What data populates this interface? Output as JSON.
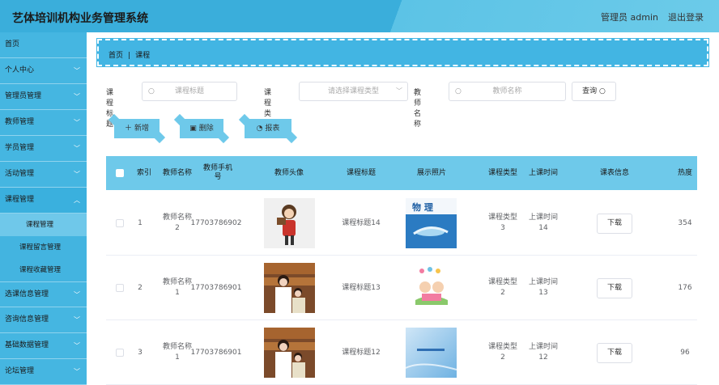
{
  "app": {
    "title": "艺体培训机构业务管理系统",
    "user": "管理员 admin",
    "logout": "退出登录"
  },
  "sidebar": {
    "items": [
      {
        "label": "首页"
      },
      {
        "label": "个人中心"
      },
      {
        "label": "管理员管理"
      },
      {
        "label": "教师管理"
      },
      {
        "label": "学员管理"
      },
      {
        "label": "活动管理"
      },
      {
        "label": "课程管理"
      },
      {
        "label": "选课信息管理"
      },
      {
        "label": "咨询信息管理"
      },
      {
        "label": "基础数据管理"
      },
      {
        "label": "论坛管理"
      }
    ],
    "subitems": [
      {
        "label": "课程管理"
      },
      {
        "label": "课程留言管理"
      },
      {
        "label": "课程收藏管理"
      }
    ]
  },
  "breadcrumb": {
    "home": "首页",
    "sep": "|",
    "current": "课程"
  },
  "search": {
    "title_label": "课程标题",
    "title_placeholder": "课程标题",
    "type_label": "课程类型",
    "type_placeholder": "请选择课程类型",
    "teacher_label": "教师名称",
    "teacher_placeholder": "教师名称",
    "query_label": "查询"
  },
  "actions": {
    "add": "新增",
    "delete": "删除",
    "report": "报表"
  },
  "table": {
    "headers": [
      "索引",
      "教师名称",
      "教师手机号",
      "教师头像",
      "课程标题",
      "展示照片",
      "课程类型",
      "上课时间",
      "课表信息",
      "热度"
    ],
    "rows": [
      {
        "index": "1",
        "teacher": "教师名称2",
        "phone": "17703786902",
        "title": "课程标题14",
        "type": "课程类型3",
        "time": "上课时间14",
        "download": "下载",
        "heat": "354"
      },
      {
        "index": "2",
        "teacher": "教师名称1",
        "phone": "17703786901",
        "title": "课程标题13",
        "type": "课程类型2",
        "time": "上课时间13",
        "download": "下载",
        "heat": "176"
      },
      {
        "index": "3",
        "teacher": "教师名称1",
        "phone": "17703786901",
        "title": "课程标题12",
        "type": "课程类型2",
        "time": "上课时间12",
        "download": "下载",
        "heat": "96"
      }
    ]
  },
  "photo_text": {
    "physics": "物 理"
  },
  "colors": {
    "accent": "#3aaedb",
    "header_bg": "#6ec9ea"
  }
}
